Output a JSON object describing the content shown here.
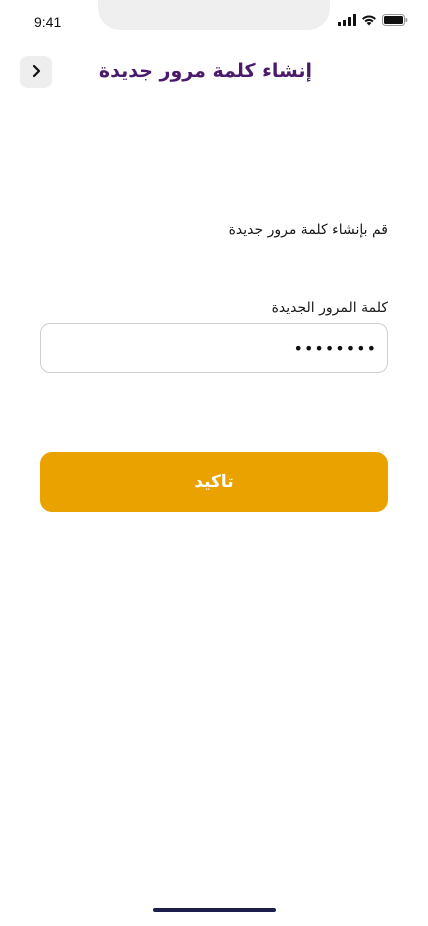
{
  "status_bar": {
    "time": "9:41"
  },
  "header": {
    "title": "إنشاء كلمة مرور جديدة",
    "back_icon": "chevron-left-icon"
  },
  "form": {
    "instruction": "قم بإنشاء كلمة مرور جديدة",
    "password_label": "كلمة المرور الجديدة",
    "password_value": "••••••••"
  },
  "actions": {
    "confirm_label": "تاكيد"
  },
  "colors": {
    "title": "#4a1a6b",
    "primary_button": "#e9a200",
    "home_indicator": "#1c1f4a"
  }
}
